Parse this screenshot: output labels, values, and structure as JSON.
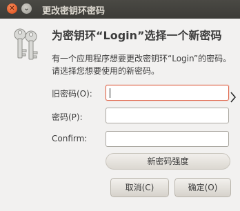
{
  "window": {
    "title": "更改密钥环密码"
  },
  "dialog": {
    "heading": "为密钥环“Login”选择一个新密码",
    "description": "有一个应用程序想要更改密钥环“Login”的密码。请选择您想要使用的新密码。"
  },
  "form": {
    "old_password_label": "旧密码(O):",
    "password_label": "密码(P):",
    "confirm_label": "Confirm:",
    "old_password_value": "",
    "password_value": "",
    "confirm_value": ""
  },
  "strength": {
    "label": "新密码强度"
  },
  "buttons": {
    "cancel": "取消(C)",
    "ok": "确定(O)"
  },
  "colors": {
    "focus_border": "#e0664b",
    "close_button": "#df4a16",
    "titlebar": "#3c3b37"
  },
  "icons": {
    "window_close": "close-icon",
    "window_minimize": "minimize-icon",
    "dialog": "keys-icon"
  }
}
